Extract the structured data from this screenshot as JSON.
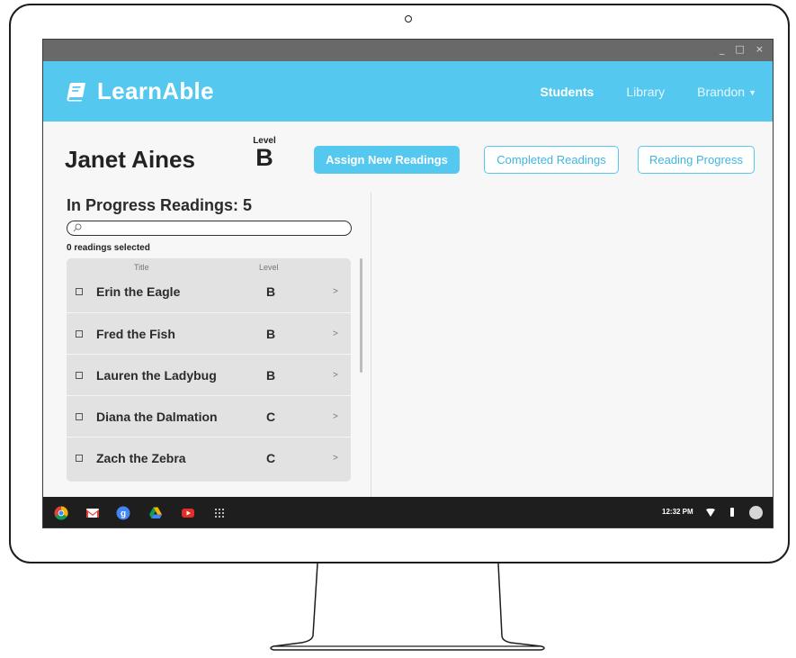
{
  "app": {
    "logo_text": "LearnAble",
    "nav": {
      "students": "Students",
      "library": "Library",
      "user": "Brandon"
    },
    "window_controls": [
      "_",
      "□",
      "×"
    ]
  },
  "student": {
    "name": "Janet Aines",
    "level_label": "Level",
    "level_value": "B"
  },
  "actions": {
    "assign": "Assign New Readings",
    "completed": "Completed Readings",
    "progress": "Reading Progress"
  },
  "in_progress": {
    "title": "In Progress Readings:  5",
    "search_placeholder": "",
    "selected_text": "0 readings selected",
    "columns": {
      "title": "Title",
      "level": "Level"
    },
    "rows": [
      {
        "title": "Erin the Eagle",
        "level": "B",
        "arrow": ">"
      },
      {
        "title": "Fred the Fish",
        "level": "B",
        "arrow": ">"
      },
      {
        "title": "Lauren the Ladybug",
        "level": "B",
        "arrow": ">"
      },
      {
        "title": "Diana the Dalmation",
        "level": "C",
        "arrow": ">"
      },
      {
        "title": "Zach the Zebra",
        "level": "C",
        "arrow": ">"
      }
    ]
  },
  "taskbar": {
    "clock": "12:32 PM",
    "apps": [
      "chrome-icon",
      "gmail-icon",
      "google-plus-icon",
      "drive-icon",
      "youtube-icon",
      "app-launcher-icon"
    ]
  },
  "colors": {
    "accent": "#55c8ef",
    "titlebar": "#696969",
    "taskbar": "#1e1e1e",
    "list_bg": "#e2e2e2"
  }
}
